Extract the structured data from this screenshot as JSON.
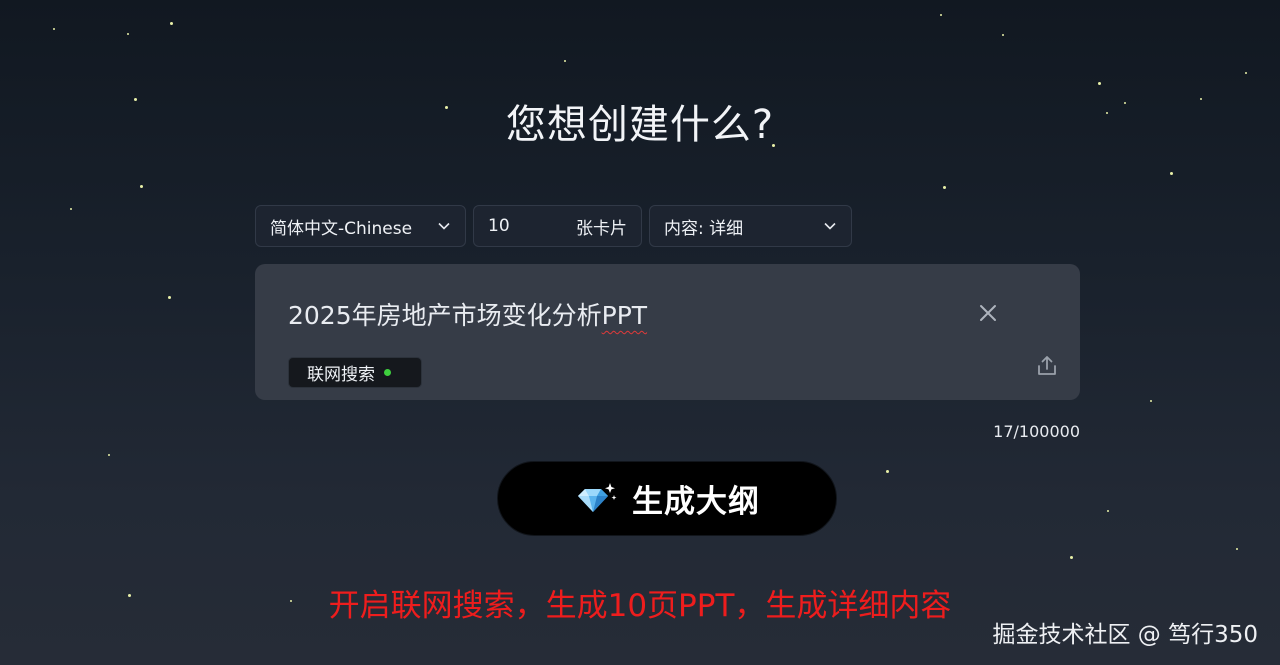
{
  "heading": "您想创建什么?",
  "language_select": {
    "value": "简体中文-Chinese"
  },
  "card_count": {
    "value": "10",
    "unit": "张卡片"
  },
  "detail_select": {
    "value": "内容: 详细"
  },
  "prompt": {
    "text_main": "2025年房地产市场变化分析",
    "text_flagged": "PPT",
    "web_search_label": "联网搜索",
    "web_search_enabled": true
  },
  "char_counter": "17/100000",
  "generate_button": {
    "label": "生成大纲"
  },
  "annotation": "开启联网搜索，生成10页PPT，生成详细内容",
  "watermark": "掘金技术社区 @ 笃行350",
  "colors": {
    "accent_green": "#3ecf3e",
    "annotation_red": "#ee1d1d",
    "button_bg": "#000000"
  }
}
